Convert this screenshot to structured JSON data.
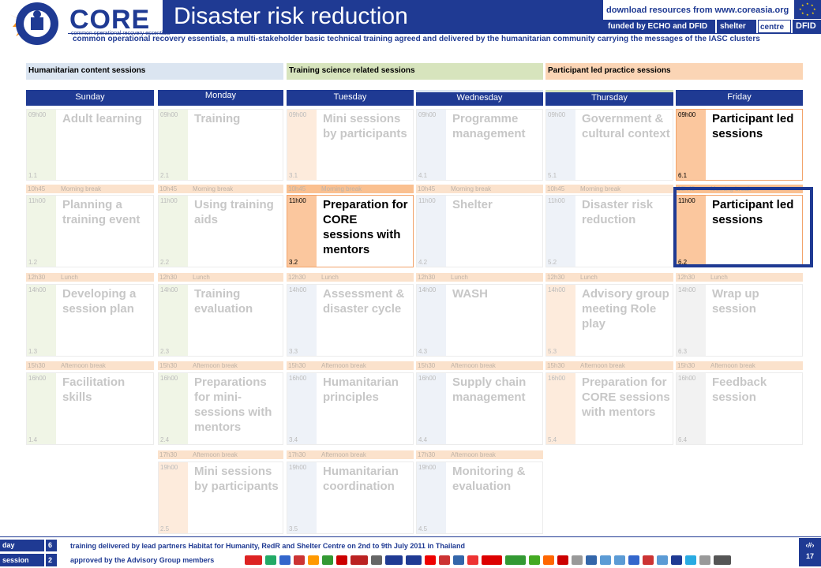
{
  "header": {
    "logo_ring_text": "common operational recovery essentials",
    "logo_word": "CORE",
    "logo_subtext": "common operational recovery essentials",
    "title": "Disaster risk reduction",
    "download": "download resources from www.coreasia.org",
    "funded": "funded by ECHO and DFID",
    "shelter": "shelter",
    "centre": "centre",
    "dfid": "DFID",
    "subline": "common operational recovery essentials, a multi-stakeholder basic technical training agreed and delivered by the humanitarian community carrying the messages of the IASC clusters"
  },
  "categories": [
    {
      "label": "Humanitarian content sessions",
      "color": "#dbe5f1"
    },
    {
      "label": "Training science related sessions",
      "color": "#d7e4bd"
    },
    {
      "label": "Participant led practice sessions",
      "color": "#fbd5b5"
    }
  ],
  "days": [
    "Sunday",
    "Monday",
    "Tuesday",
    "Wednesday",
    "Thursday",
    "Friday"
  ],
  "breaks": {
    "morning": {
      "time": "10h45",
      "label": "Morning break"
    },
    "lunch": {
      "time": "12h30",
      "label": "Lunch"
    },
    "afternoon": {
      "time": "15h30",
      "label": "Afternoon break"
    },
    "late": {
      "time": "17h30",
      "label": "Afternoon break"
    }
  },
  "sessions": {
    "sun": [
      {
        "time": "09h00",
        "title": "Adult learning",
        "code": "1.1"
      },
      {
        "time": "11h00",
        "title": "Planning a training event",
        "code": "1.2"
      },
      {
        "time": "14h00",
        "title": "Developing a session plan",
        "code": "1.3"
      },
      {
        "time": "16h00",
        "title": "Facilitation skills",
        "code": "1.4"
      }
    ],
    "mon": [
      {
        "time": "09h00",
        "title": "Training",
        "code": "2.1"
      },
      {
        "time": "11h00",
        "title": "Using training aids",
        "code": "2.2"
      },
      {
        "time": "14h00",
        "title": "Training evaluation",
        "code": "2.3"
      },
      {
        "time": "16h00",
        "title": "Preparations for mini-sessions with mentors",
        "code": "2.4"
      },
      {
        "time": "19h00",
        "title": "Mini sessions by participants",
        "code": "2.5"
      }
    ],
    "tue": [
      {
        "time": "09h00",
        "title": "Mini sessions by participants",
        "code": "3.1"
      },
      {
        "time": "11h00",
        "title": "Preparation for CORE sessions with mentors",
        "code": "3.2"
      },
      {
        "time": "14h00",
        "title": "Assessment & disaster cycle",
        "code": "3.3"
      },
      {
        "time": "16h00",
        "title": "Humanitarian principles",
        "code": "3.4"
      },
      {
        "time": "19h00",
        "title": "Humanitarian coordination",
        "code": "3.5"
      }
    ],
    "wed": [
      {
        "time": "09h00",
        "title": "Programme management",
        "code": "4.1"
      },
      {
        "time": "11h00",
        "title": "Shelter",
        "code": "4.2"
      },
      {
        "time": "14h00",
        "title": "WASH",
        "code": "4.3"
      },
      {
        "time": "16h00",
        "title": "Supply chain management",
        "code": "4.4"
      },
      {
        "time": "19h00",
        "title": "Monitoring & evaluation",
        "code": "4.5"
      }
    ],
    "thu": [
      {
        "time": "09h00",
        "title": "Government & cultural context",
        "code": "5.1"
      },
      {
        "time": "11h00",
        "title": "Disaster risk reduction",
        "code": "5.2"
      },
      {
        "time": "14h00",
        "title": "Advisory group meeting Role play",
        "code": "5.3"
      },
      {
        "time": "16h00",
        "title": "Preparation for CORE sessions with mentors",
        "code": "5.4"
      }
    ],
    "fri": [
      {
        "time": "09h00",
        "title": "Participant led sessions",
        "code": "6.1"
      },
      {
        "time": "11h00",
        "title": "Participant led sessions",
        "code": "6.2"
      },
      {
        "time": "14h00",
        "title": "Wrap up session",
        "code": "6.3"
      },
      {
        "time": "16h00",
        "title": "Feedback session",
        "code": "6.4"
      }
    ]
  },
  "footer": {
    "day_label": "day",
    "day_value": "6",
    "session_label": "session",
    "session_value": "2",
    "line1": "training delivered by lead partners Habitat for Humanity, RedR and Shelter Centre on 2nd to 9th July 2011 in Thailand",
    "line2": "approved by the Advisory Group members",
    "page": "17",
    "page_mark": "‹#›"
  },
  "colors": {
    "navy": "#1f3a93",
    "blue_cell": "#dbe5f1",
    "green_cell": "#d7e4bd",
    "orange_cell": "#fbd5b5",
    "orange_strong": "#fac090"
  }
}
